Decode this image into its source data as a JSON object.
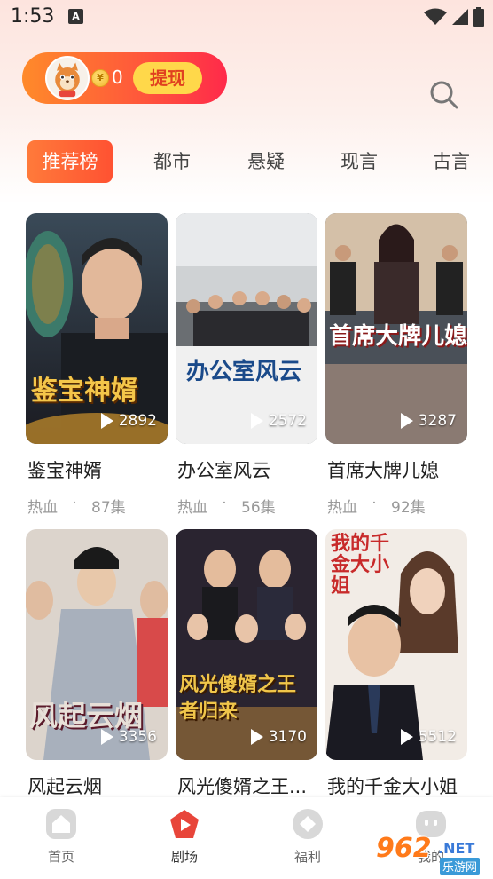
{
  "status_bar": {
    "time": "1:53",
    "notification": "A"
  },
  "header": {
    "coins": "0",
    "withdraw_label": "提现"
  },
  "tabs": [
    {
      "label": "推荐榜",
      "active": true
    },
    {
      "label": "都市",
      "active": false
    },
    {
      "label": "悬疑",
      "active": false
    },
    {
      "label": "现言",
      "active": false
    },
    {
      "label": "古言",
      "active": false
    }
  ],
  "dramas": [
    {
      "poster_text": "鉴宝神婿",
      "plays": "2892",
      "title": "鉴宝神婿",
      "genre": "热血",
      "dot": "·",
      "episodes": "87集"
    },
    {
      "poster_text": "办公室风云",
      "plays": "2572",
      "title": "办公室风云",
      "genre": "热血",
      "dot": "·",
      "episodes": "56集"
    },
    {
      "poster_text": "首席大牌儿媳",
      "plays": "3287",
      "title": "首席大牌儿媳",
      "genre": "热血",
      "dot": "·",
      "episodes": "92集"
    },
    {
      "poster_text": "风起云烟",
      "plays": "3356",
      "title": "风起云烟"
    },
    {
      "poster_text": "风光傻婿之王者归来",
      "plays": "3170",
      "title": "风光傻婿之王..."
    },
    {
      "poster_text": "我的千金大小姐",
      "plays": "5512",
      "title": "我的千金大小姐"
    }
  ],
  "bottom_nav": [
    {
      "label": "首页",
      "icon": "home-icon"
    },
    {
      "label": "剧场",
      "icon": "theater-play-icon",
      "active": true,
      "accent": "#e8453a"
    },
    {
      "label": "福利",
      "icon": "welfare-icon"
    },
    {
      "label": "我的",
      "icon": "profile-icon"
    }
  ],
  "watermark": {
    "num": "962",
    "net": ".NET",
    "sub": "乐游网"
  },
  "colors": {
    "accent": "#ff5a3a",
    "coin": "#f3b52a",
    "withdraw_bg": "#ffd84a"
  }
}
